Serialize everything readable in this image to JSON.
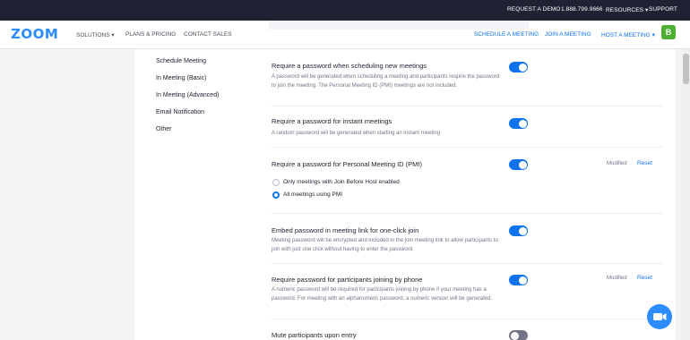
{
  "topbar": {
    "request_demo": "REQUEST A DEMO",
    "phone": "1.888.799.9666",
    "resources": "RESOURCES ▾",
    "support": "SUPPORT"
  },
  "nav": {
    "logo": "zoom",
    "solutions": "SOLUTIONS ▾",
    "plans": "PLANS & PRICING",
    "contact": "CONTACT SALES",
    "schedule": "SCHEDULE A MEETING",
    "join": "JOIN A MEETING",
    "host": "HOST A MEETING ▾",
    "avatar_initial": "B"
  },
  "sidebar": {
    "items": [
      {
        "label": "Schedule Meeting"
      },
      {
        "label": "In Meeting (Basic)"
      },
      {
        "label": "In Meeting (Advanced)"
      },
      {
        "label": "Email Notification"
      },
      {
        "label": "Other"
      }
    ]
  },
  "settings": [
    {
      "title": "Require a password when scheduling new meetings",
      "desc": "A password will be generated when scheduling a meeting and participants require the password to join the meeting. The Personal Meeting ID (PMI) meetings are not included.",
      "enabled": true
    },
    {
      "title": "Require a password for instant meetings",
      "desc": "A random password will be generated when starting an instant meeting",
      "enabled": true
    },
    {
      "title": "Require a password for Personal Meeting ID (PMI)",
      "enabled": true,
      "modified": "Modified",
      "reset": "Reset",
      "options": [
        {
          "label": "Only meetings with Join Before Host enabled",
          "selected": false
        },
        {
          "label": "All meetings using PMI",
          "selected": true
        }
      ]
    },
    {
      "title": "Embed password in meeting link for one-click join",
      "desc": "Meeting password will be encrypted and included in the join meeting link to allow participants to join with just one click without having to enter the password.",
      "enabled": true
    },
    {
      "title": "Require password for participants joining by phone",
      "desc": "A numeric password will be required for participants joining by phone if your meeting has a password. For meeting with an alphanumeric password, a numeric version will be generated.",
      "enabled": true,
      "modified": "Modified",
      "reset": "Reset"
    },
    {
      "title": "Mute participants upon entry",
      "enabled": false
    }
  ],
  "colors": {
    "accent": "#0e72ed",
    "logo": "#2d8cff",
    "topbar": "#1f2233",
    "avatar": "#4eae32"
  }
}
